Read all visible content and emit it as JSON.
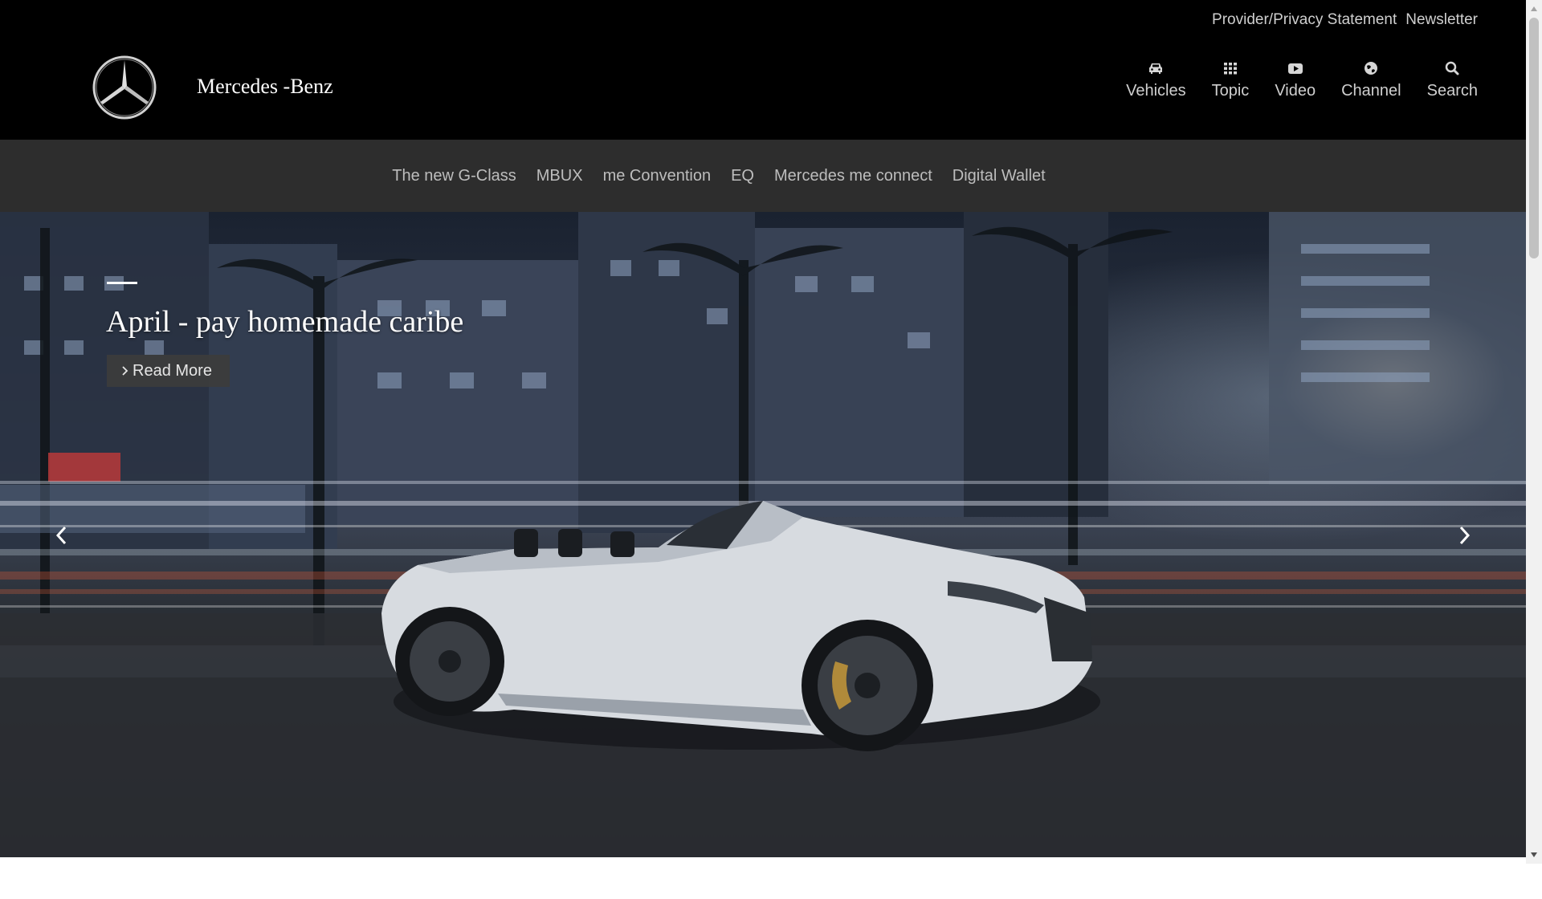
{
  "header": {
    "brand": "Mercedes -Benz",
    "util_links": [
      {
        "label": "Provider/Privacy Statement"
      },
      {
        "label": "Newsletter"
      }
    ],
    "nav": [
      {
        "label": "Vehicles",
        "icon": "car-icon"
      },
      {
        "label": "Topic",
        "icon": "grid-icon"
      },
      {
        "label": "Video",
        "icon": "video-icon"
      },
      {
        "label": "Channel",
        "icon": "globe-icon"
      },
      {
        "label": "Search",
        "icon": "search-icon"
      }
    ]
  },
  "subnav": {
    "items": [
      {
        "label": "The new G-Class"
      },
      {
        "label": "MBUX"
      },
      {
        "label": "me Convention"
      },
      {
        "label": "EQ"
      },
      {
        "label": "Mercedes me connect"
      },
      {
        "label": "Digital Wallet"
      }
    ]
  },
  "hero": {
    "title": "April - pay homemade caribe",
    "button_label": "Read More",
    "button_icon": "chevron-right-icon",
    "prev_icon": "chevron-left-icon",
    "next_icon": "chevron-right-icon"
  },
  "colors": {
    "header_bg": "#000000",
    "subnav_bg": "#2d2d2d",
    "nav_text": "#cfcfcf",
    "button_bg": "#3c3c3c"
  }
}
